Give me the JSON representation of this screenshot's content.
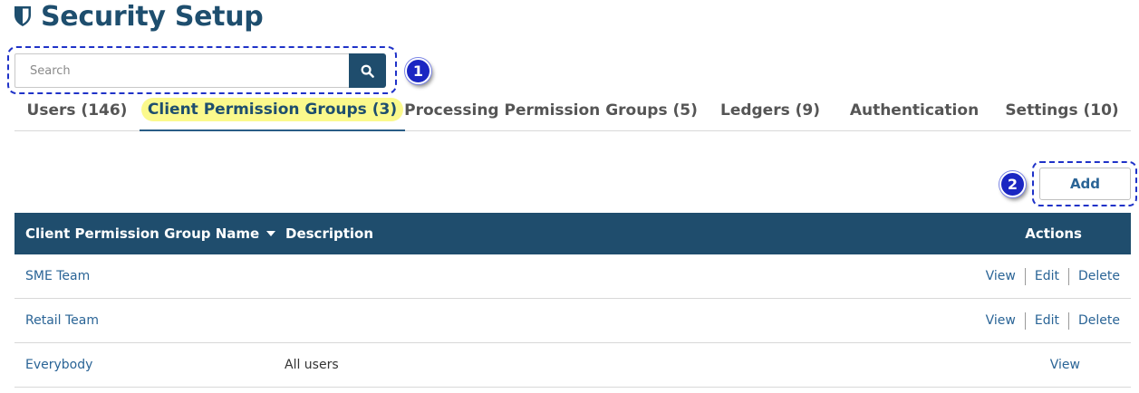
{
  "page": {
    "title": "Security Setup",
    "title_icon": "shield-icon",
    "brand_color": "#1e4e6e"
  },
  "search": {
    "placeholder": "Search",
    "value": "",
    "button_icon": "search-icon"
  },
  "annotations": {
    "step1": "1",
    "step2": "2"
  },
  "tabs": [
    {
      "label": "Users (146)",
      "active": false
    },
    {
      "label": "Client Permission Groups (3)",
      "active": true
    },
    {
      "label": "Processing Permission Groups (5)",
      "active": false
    },
    {
      "label": "Ledgers (9)",
      "active": false
    },
    {
      "label": "Authentication",
      "active": false
    },
    {
      "label": "Settings (10)",
      "active": false
    }
  ],
  "toolbar": {
    "add_label": "Add"
  },
  "table": {
    "header_color": "#1f4d6d",
    "columns": {
      "name": "Client Permission Group Name",
      "name_sort_icon": "sort-down-icon",
      "description": "Description",
      "actions": "Actions"
    },
    "rows": [
      {
        "name": "SME Team",
        "description": "",
        "actions": [
          "View",
          "Edit",
          "Delete"
        ]
      },
      {
        "name": "Retail Team",
        "description": "",
        "actions": [
          "View",
          "Edit",
          "Delete"
        ]
      },
      {
        "name": "Everybody",
        "description": "All users",
        "actions": [
          "View"
        ]
      }
    ]
  }
}
